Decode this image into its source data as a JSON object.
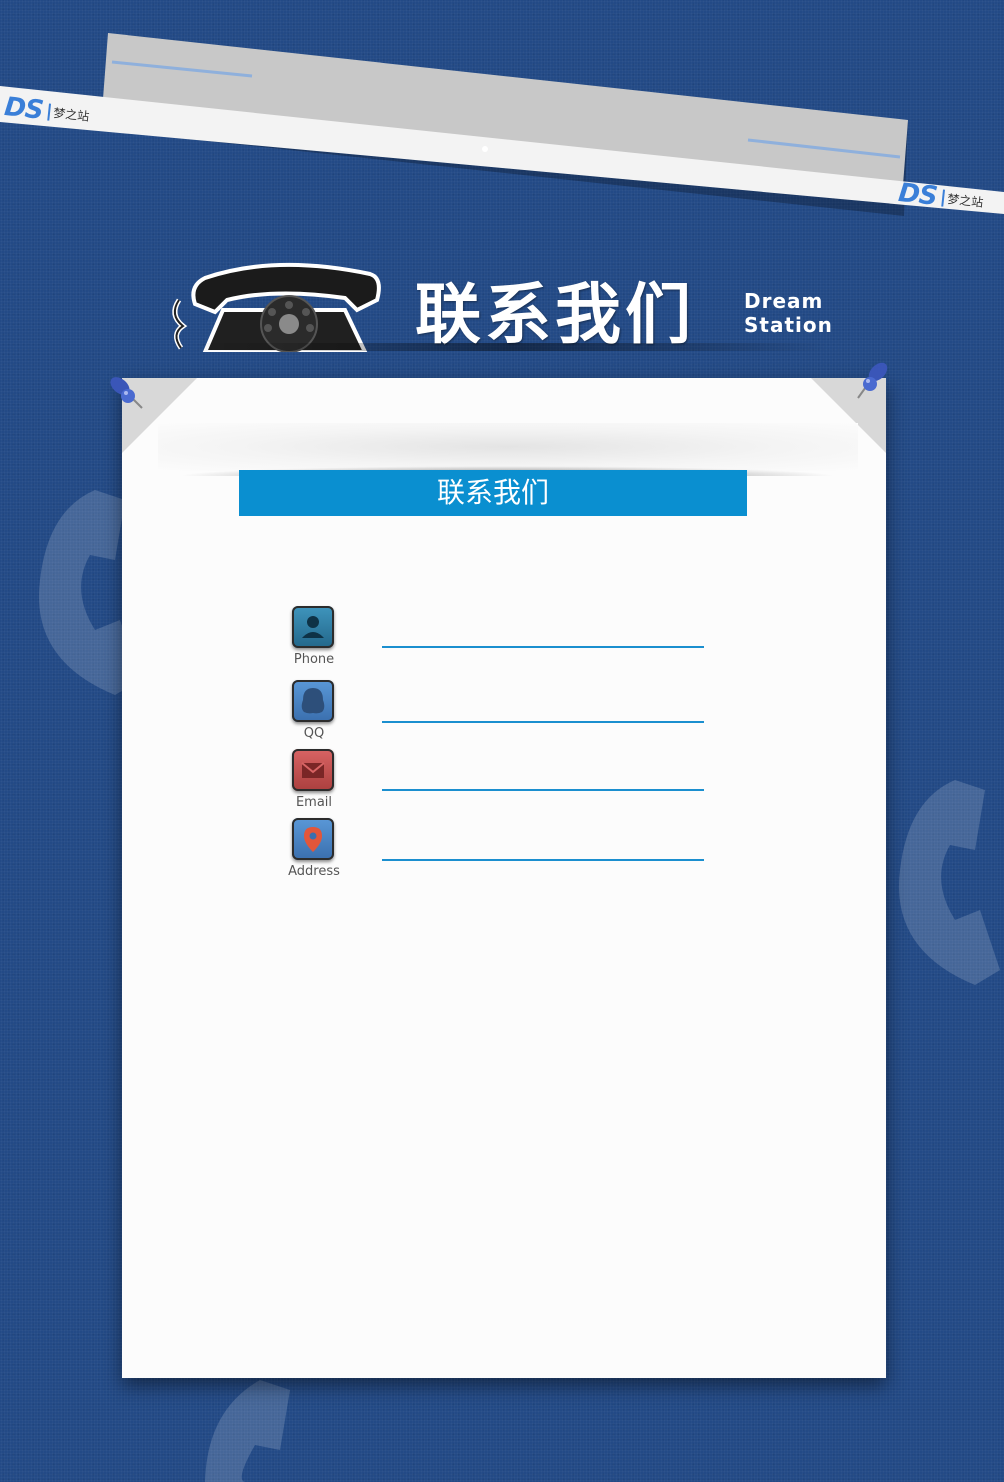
{
  "brand": {
    "logo_text": "DS",
    "logo_cn": "梦之站",
    "logo_en": "Dream Station"
  },
  "header": {
    "title_cn": "联系我们",
    "subtitle_en": "Dream Station"
  },
  "card": {
    "title": "联系我们"
  },
  "contacts": [
    {
      "label": "Phone",
      "icon": "person-icon",
      "color": "#2e7fa6",
      "value": ""
    },
    {
      "label": "QQ",
      "icon": "penguin-icon",
      "color": "#4a86c6",
      "value": ""
    },
    {
      "label": "Email",
      "icon": "envelope-icon",
      "color": "#c4504f",
      "value": ""
    },
    {
      "label": "Address",
      "icon": "map-pin-icon",
      "color": "#4a86c6",
      "value": ""
    }
  ],
  "colors": {
    "background": "#234a86",
    "accent": "#0a8fd0",
    "card": "#fcfcfc"
  }
}
